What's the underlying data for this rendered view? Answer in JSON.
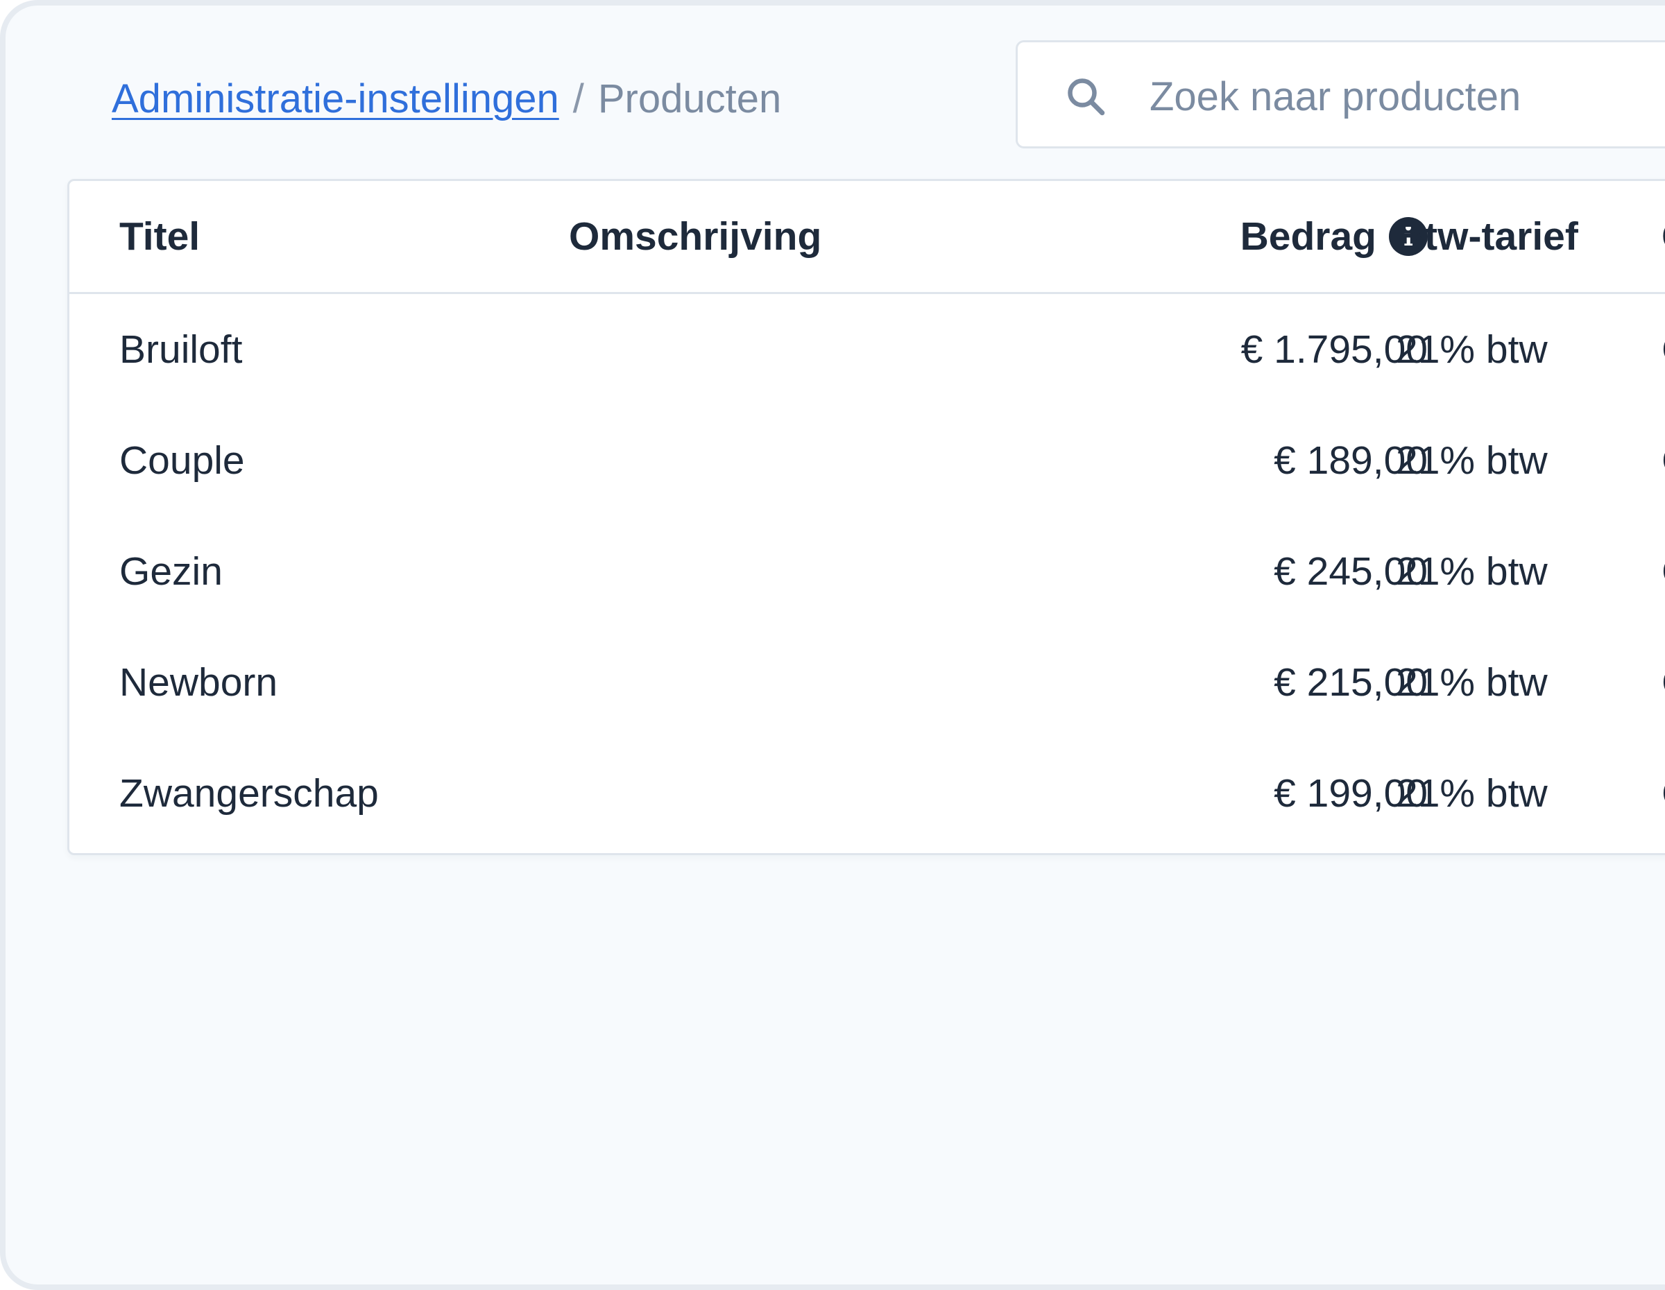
{
  "breadcrumb": {
    "parent": "Administratie-instellingen",
    "separator": "/",
    "current": "Producten"
  },
  "search": {
    "placeholder": "Zoek naar producten",
    "value": "",
    "icon": "search-icon"
  },
  "table": {
    "columns": {
      "title": "Titel",
      "description": "Omschrijving",
      "amount": "Bedrag",
      "vat": "Btw-tarief",
      "extra": "C"
    },
    "rows": [
      {
        "title": "Bruiloft",
        "description": "",
        "amount": "€ 1.795,00",
        "vat": "21% btw",
        "extra": "C"
      },
      {
        "title": "Couple",
        "description": "",
        "amount": "€ 189,00",
        "vat": "21% btw",
        "extra": "C"
      },
      {
        "title": "Gezin",
        "description": "",
        "amount": "€ 245,00",
        "vat": "21% btw",
        "extra": "C"
      },
      {
        "title": "Newborn",
        "description": "",
        "amount": "€ 215,00",
        "vat": "21% btw",
        "extra": "C"
      },
      {
        "title": "Zwangerschap",
        "description": "",
        "amount": "€ 199,00",
        "vat": "21% btw",
        "extra": "C"
      }
    ]
  },
  "colors": {
    "link": "#2f6fdb",
    "text": "#1e2a3b",
    "muted": "#7b8ba1",
    "border": "#dfe5ec",
    "background": "#f7fafd"
  }
}
